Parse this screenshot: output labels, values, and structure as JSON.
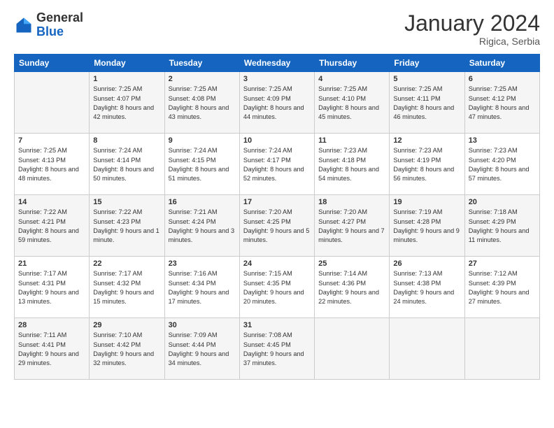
{
  "header": {
    "logo": {
      "general": "General",
      "blue": "Blue"
    },
    "month": "January 2024",
    "location": "Rigica, Serbia"
  },
  "weekdays": [
    "Sunday",
    "Monday",
    "Tuesday",
    "Wednesday",
    "Thursday",
    "Friday",
    "Saturday"
  ],
  "weeks": [
    [
      {
        "day": "",
        "sunrise": "",
        "sunset": "",
        "daylight": ""
      },
      {
        "day": "1",
        "sunrise": "Sunrise: 7:25 AM",
        "sunset": "Sunset: 4:07 PM",
        "daylight": "Daylight: 8 hours and 42 minutes."
      },
      {
        "day": "2",
        "sunrise": "Sunrise: 7:25 AM",
        "sunset": "Sunset: 4:08 PM",
        "daylight": "Daylight: 8 hours and 43 minutes."
      },
      {
        "day": "3",
        "sunrise": "Sunrise: 7:25 AM",
        "sunset": "Sunset: 4:09 PM",
        "daylight": "Daylight: 8 hours and 44 minutes."
      },
      {
        "day": "4",
        "sunrise": "Sunrise: 7:25 AM",
        "sunset": "Sunset: 4:10 PM",
        "daylight": "Daylight: 8 hours and 45 minutes."
      },
      {
        "day": "5",
        "sunrise": "Sunrise: 7:25 AM",
        "sunset": "Sunset: 4:11 PM",
        "daylight": "Daylight: 8 hours and 46 minutes."
      },
      {
        "day": "6",
        "sunrise": "Sunrise: 7:25 AM",
        "sunset": "Sunset: 4:12 PM",
        "daylight": "Daylight: 8 hours and 47 minutes."
      }
    ],
    [
      {
        "day": "7",
        "sunrise": "Sunrise: 7:25 AM",
        "sunset": "Sunset: 4:13 PM",
        "daylight": "Daylight: 8 hours and 48 minutes."
      },
      {
        "day": "8",
        "sunrise": "Sunrise: 7:24 AM",
        "sunset": "Sunset: 4:14 PM",
        "daylight": "Daylight: 8 hours and 50 minutes."
      },
      {
        "day": "9",
        "sunrise": "Sunrise: 7:24 AM",
        "sunset": "Sunset: 4:15 PM",
        "daylight": "Daylight: 8 hours and 51 minutes."
      },
      {
        "day": "10",
        "sunrise": "Sunrise: 7:24 AM",
        "sunset": "Sunset: 4:17 PM",
        "daylight": "Daylight: 8 hours and 52 minutes."
      },
      {
        "day": "11",
        "sunrise": "Sunrise: 7:23 AM",
        "sunset": "Sunset: 4:18 PM",
        "daylight": "Daylight: 8 hours and 54 minutes."
      },
      {
        "day": "12",
        "sunrise": "Sunrise: 7:23 AM",
        "sunset": "Sunset: 4:19 PM",
        "daylight": "Daylight: 8 hours and 56 minutes."
      },
      {
        "day": "13",
        "sunrise": "Sunrise: 7:23 AM",
        "sunset": "Sunset: 4:20 PM",
        "daylight": "Daylight: 8 hours and 57 minutes."
      }
    ],
    [
      {
        "day": "14",
        "sunrise": "Sunrise: 7:22 AM",
        "sunset": "Sunset: 4:21 PM",
        "daylight": "Daylight: 8 hours and 59 minutes."
      },
      {
        "day": "15",
        "sunrise": "Sunrise: 7:22 AM",
        "sunset": "Sunset: 4:23 PM",
        "daylight": "Daylight: 9 hours and 1 minute."
      },
      {
        "day": "16",
        "sunrise": "Sunrise: 7:21 AM",
        "sunset": "Sunset: 4:24 PM",
        "daylight": "Daylight: 9 hours and 3 minutes."
      },
      {
        "day": "17",
        "sunrise": "Sunrise: 7:20 AM",
        "sunset": "Sunset: 4:25 PM",
        "daylight": "Daylight: 9 hours and 5 minutes."
      },
      {
        "day": "18",
        "sunrise": "Sunrise: 7:20 AM",
        "sunset": "Sunset: 4:27 PM",
        "daylight": "Daylight: 9 hours and 7 minutes."
      },
      {
        "day": "19",
        "sunrise": "Sunrise: 7:19 AM",
        "sunset": "Sunset: 4:28 PM",
        "daylight": "Daylight: 9 hours and 9 minutes."
      },
      {
        "day": "20",
        "sunrise": "Sunrise: 7:18 AM",
        "sunset": "Sunset: 4:29 PM",
        "daylight": "Daylight: 9 hours and 11 minutes."
      }
    ],
    [
      {
        "day": "21",
        "sunrise": "Sunrise: 7:17 AM",
        "sunset": "Sunset: 4:31 PM",
        "daylight": "Daylight: 9 hours and 13 minutes."
      },
      {
        "day": "22",
        "sunrise": "Sunrise: 7:17 AM",
        "sunset": "Sunset: 4:32 PM",
        "daylight": "Daylight: 9 hours and 15 minutes."
      },
      {
        "day": "23",
        "sunrise": "Sunrise: 7:16 AM",
        "sunset": "Sunset: 4:34 PM",
        "daylight": "Daylight: 9 hours and 17 minutes."
      },
      {
        "day": "24",
        "sunrise": "Sunrise: 7:15 AM",
        "sunset": "Sunset: 4:35 PM",
        "daylight": "Daylight: 9 hours and 20 minutes."
      },
      {
        "day": "25",
        "sunrise": "Sunrise: 7:14 AM",
        "sunset": "Sunset: 4:36 PM",
        "daylight": "Daylight: 9 hours and 22 minutes."
      },
      {
        "day": "26",
        "sunrise": "Sunrise: 7:13 AM",
        "sunset": "Sunset: 4:38 PM",
        "daylight": "Daylight: 9 hours and 24 minutes."
      },
      {
        "day": "27",
        "sunrise": "Sunrise: 7:12 AM",
        "sunset": "Sunset: 4:39 PM",
        "daylight": "Daylight: 9 hours and 27 minutes."
      }
    ],
    [
      {
        "day": "28",
        "sunrise": "Sunrise: 7:11 AM",
        "sunset": "Sunset: 4:41 PM",
        "daylight": "Daylight: 9 hours and 29 minutes."
      },
      {
        "day": "29",
        "sunrise": "Sunrise: 7:10 AM",
        "sunset": "Sunset: 4:42 PM",
        "daylight": "Daylight: 9 hours and 32 minutes."
      },
      {
        "day": "30",
        "sunrise": "Sunrise: 7:09 AM",
        "sunset": "Sunset: 4:44 PM",
        "daylight": "Daylight: 9 hours and 34 minutes."
      },
      {
        "day": "31",
        "sunrise": "Sunrise: 7:08 AM",
        "sunset": "Sunset: 4:45 PM",
        "daylight": "Daylight: 9 hours and 37 minutes."
      },
      {
        "day": "",
        "sunrise": "",
        "sunset": "",
        "daylight": ""
      },
      {
        "day": "",
        "sunrise": "",
        "sunset": "",
        "daylight": ""
      },
      {
        "day": "",
        "sunrise": "",
        "sunset": "",
        "daylight": ""
      }
    ]
  ]
}
